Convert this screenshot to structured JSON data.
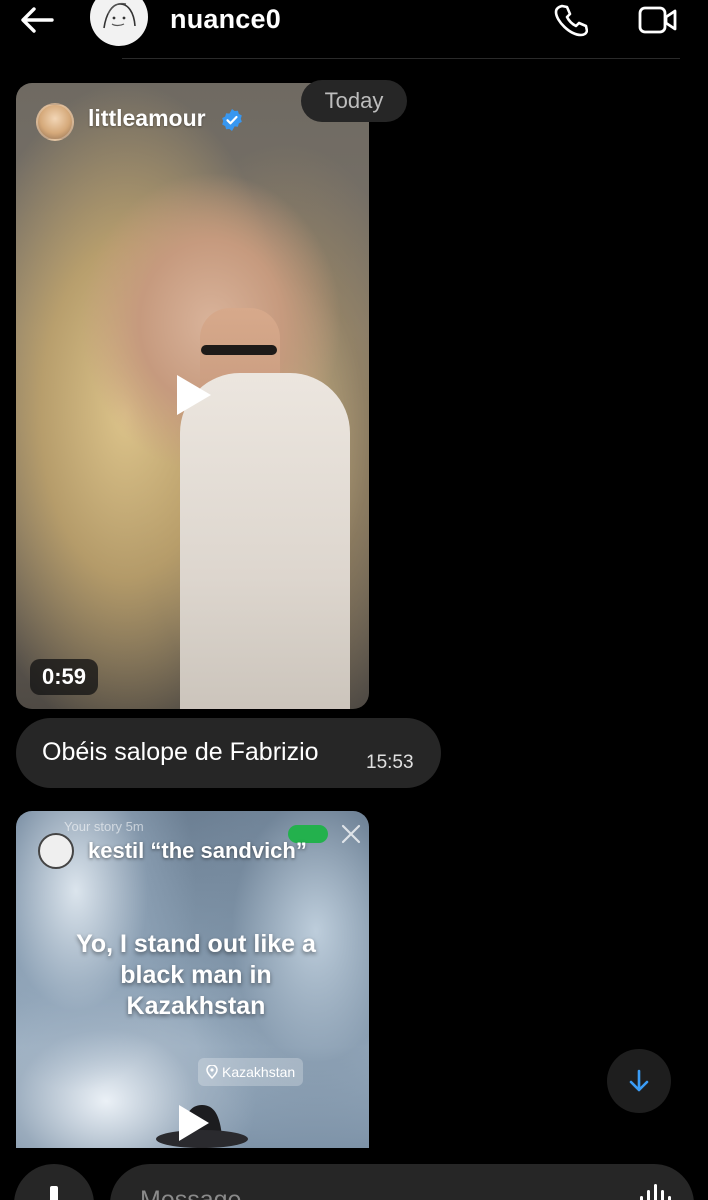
{
  "header": {
    "username": "nuance0",
    "icons": [
      "back-arrow-icon",
      "phone-icon",
      "video-camera-icon"
    ]
  },
  "thread": {
    "date_label": "Today",
    "reel": {
      "username": "littleamour",
      "verified": true,
      "duration": "0:59",
      "icon": "play-icon"
    },
    "message": {
      "text": "Obéis salope de Fabrizio",
      "time": "15:53"
    },
    "story": {
      "meta": "Your story  5m",
      "username": "kestil “the sandvich”",
      "caption": "Yo, I stand out like a black man in Kazakhstan",
      "location": "Kazakhstan",
      "icon": "play-icon"
    }
  },
  "composer": {
    "placeholder": "Message",
    "icons": [
      "plus-icon",
      "audio-waveform-icon"
    ]
  },
  "colors": {
    "background": "#000000",
    "bubble": "#262626",
    "verified": "#3897f0",
    "scroll_arrow": "#3b9cf5"
  }
}
